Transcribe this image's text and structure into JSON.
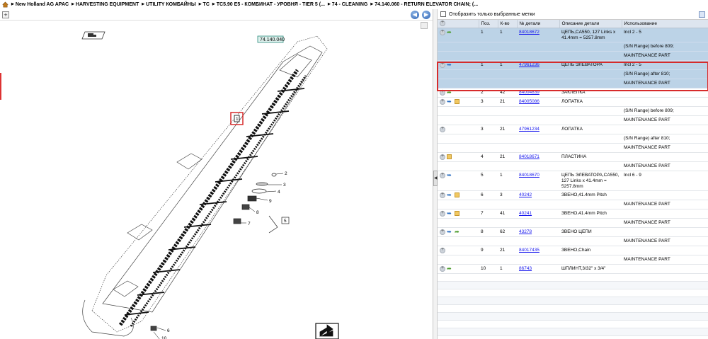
{
  "breadcrumb": [
    "New Holland AG APAC",
    "HARVESTING EQUIPMENT",
    "UTILITY КОМБАЙНЫ",
    "TC",
    "TC5.90 E5 - КОМБИНАТ - УРОВНЯ - TIER 5 (...",
    "74 - CLEANING",
    "74.140.060 - RETURN ELEVATOR CHAIN; (..."
  ],
  "left": {
    "zoom_label": "+",
    "prev_label": "◀",
    "next_label": "▶",
    "diagram": {
      "ref_label": "74.140.040",
      "callouts": [
        "1",
        "2",
        "3",
        "4",
        "9",
        "8",
        "5",
        "7",
        "6",
        "10"
      ]
    }
  },
  "filter": {
    "label": "Отобразить только выбранные метки"
  },
  "table": {
    "headers": [
      "",
      "Поз.",
      "К-во",
      "№ детали",
      "Описание детали",
      "Использование"
    ],
    "rows": [
      {
        "icons": [
          "plus",
          "arrow"
        ],
        "pos": "1",
        "qty": "1",
        "part": "84018672",
        "desc": "ЦЕПЬ,CA550, 127 Links x 41.4mm = 5257.8mm",
        "usage": "Incl 2 - 5",
        "sel": true,
        "subs": [
          "(S/N Range) before 809;",
          "MAINTENANCE PART"
        ]
      },
      {
        "icons": [
          "plus",
          "swap"
        ],
        "pos": "1",
        "qty": "1",
        "part": "47961236",
        "desc": "ЦЕПЬ ЭЛЕВАТОРА",
        "usage": "Incl 2 - 5",
        "sel": true,
        "subs": [
          "(S/N Range) after 810;",
          "MAINTENANCE PART"
        ]
      },
      {
        "icons": [
          "plus",
          "arrow"
        ],
        "pos": "2",
        "qty": "42",
        "part": "84004839",
        "desc": "ЗАКЛЕПКА",
        "usage": "",
        "sel": false,
        "subs": []
      },
      {
        "icons": [
          "plus",
          "swap",
          "box"
        ],
        "pos": "3",
        "qty": "21",
        "part": "84005086",
        "desc": "ЛОПАТКА",
        "usage": "",
        "sel": false,
        "subs": [
          "(S/N Range) before 809;",
          "MAINTENANCE PART"
        ]
      },
      {
        "icons": [
          "plus"
        ],
        "pos": "3",
        "qty": "21",
        "part": "47961234",
        "desc": "ЛОПАТКА",
        "usage": "",
        "sel": false,
        "subs": [
          "(S/N Range) after 810;",
          "MAINTENANCE PART"
        ]
      },
      {
        "icons": [
          "plus",
          "box"
        ],
        "pos": "4",
        "qty": "21",
        "part": "84018671",
        "desc": "ПЛАСТИНА",
        "usage": "",
        "sel": false,
        "subs": [
          "MAINTENANCE PART"
        ]
      },
      {
        "icons": [
          "plus",
          "swap"
        ],
        "pos": "5",
        "qty": "1",
        "part": "84018670",
        "desc": "ЦЕПЬ ЭЛЕВАТОРА,CA550, 127 Links x 41.4mm = 5257.8mm",
        "usage": "Incl 6 - 9",
        "sel": false,
        "subs": []
      },
      {
        "icons": [
          "plus",
          "swap",
          "box"
        ],
        "pos": "6",
        "qty": "3",
        "part": "40242",
        "desc": "ЗВЕНО,41.4mm Pitch",
        "usage": "",
        "sel": false,
        "subs": [
          "MAINTENANCE PART"
        ]
      },
      {
        "icons": [
          "plus",
          "swap",
          "box"
        ],
        "pos": "7",
        "qty": "41",
        "part": "40241",
        "desc": "ЗВЕНО,41.4mm Pitch",
        "usage": "",
        "sel": false,
        "subs": [
          "MAINTENANCE PART"
        ]
      },
      {
        "icons": [
          "plus",
          "swap",
          "arrow"
        ],
        "pos": "8",
        "qty": "62",
        "part": "43278",
        "desc": "ЗВЕНО ЦЕПИ",
        "usage": "",
        "sel": false,
        "subs": [
          "MAINTENANCE PART"
        ]
      },
      {
        "icons": [
          "plus"
        ],
        "pos": "9",
        "qty": "21",
        "part": "84017435",
        "desc": "ЗВЕНО,Chain",
        "usage": "",
        "sel": false,
        "subs": [
          "MAINTENANCE PART"
        ]
      },
      {
        "icons": [
          "plus",
          "arrow"
        ],
        "pos": "10",
        "qty": "1",
        "part": "86743",
        "desc": "ШПЛИНТ,3/32\" x 3/4\"",
        "usage": "",
        "sel": false,
        "subs": []
      }
    ]
  },
  "icons": {
    "home": "home-icon",
    "plus": "expand-icon",
    "arrow": "green-arrow-icon",
    "swap": "blue-swap-icon",
    "box": "package-icon",
    "filter": "filter-icon"
  },
  "colors": {
    "selected_row": "#bcd3e7",
    "header": "#dde5ef",
    "highlight": "#d72b2b",
    "link": "#1a1aee"
  }
}
